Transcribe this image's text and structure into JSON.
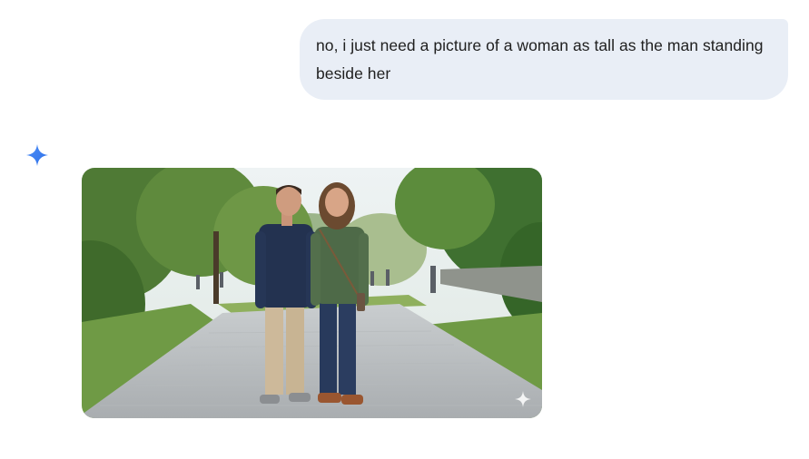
{
  "conversation": {
    "user_message": {
      "text": "no, i just need a picture of a woman as tall as the man standing beside her"
    },
    "assistant_response": {
      "avatar_icon": "gemini-sparkle-icon",
      "image": {
        "subject": "man and woman of equal height standing side by side on a park path",
        "watermark_icon": "sparkle-watermark-icon"
      }
    }
  },
  "colors": {
    "user_bubble_bg": "#e9eef6",
    "text_primary": "#1f1f1f",
    "sparkle_accent": "#4285f4"
  }
}
